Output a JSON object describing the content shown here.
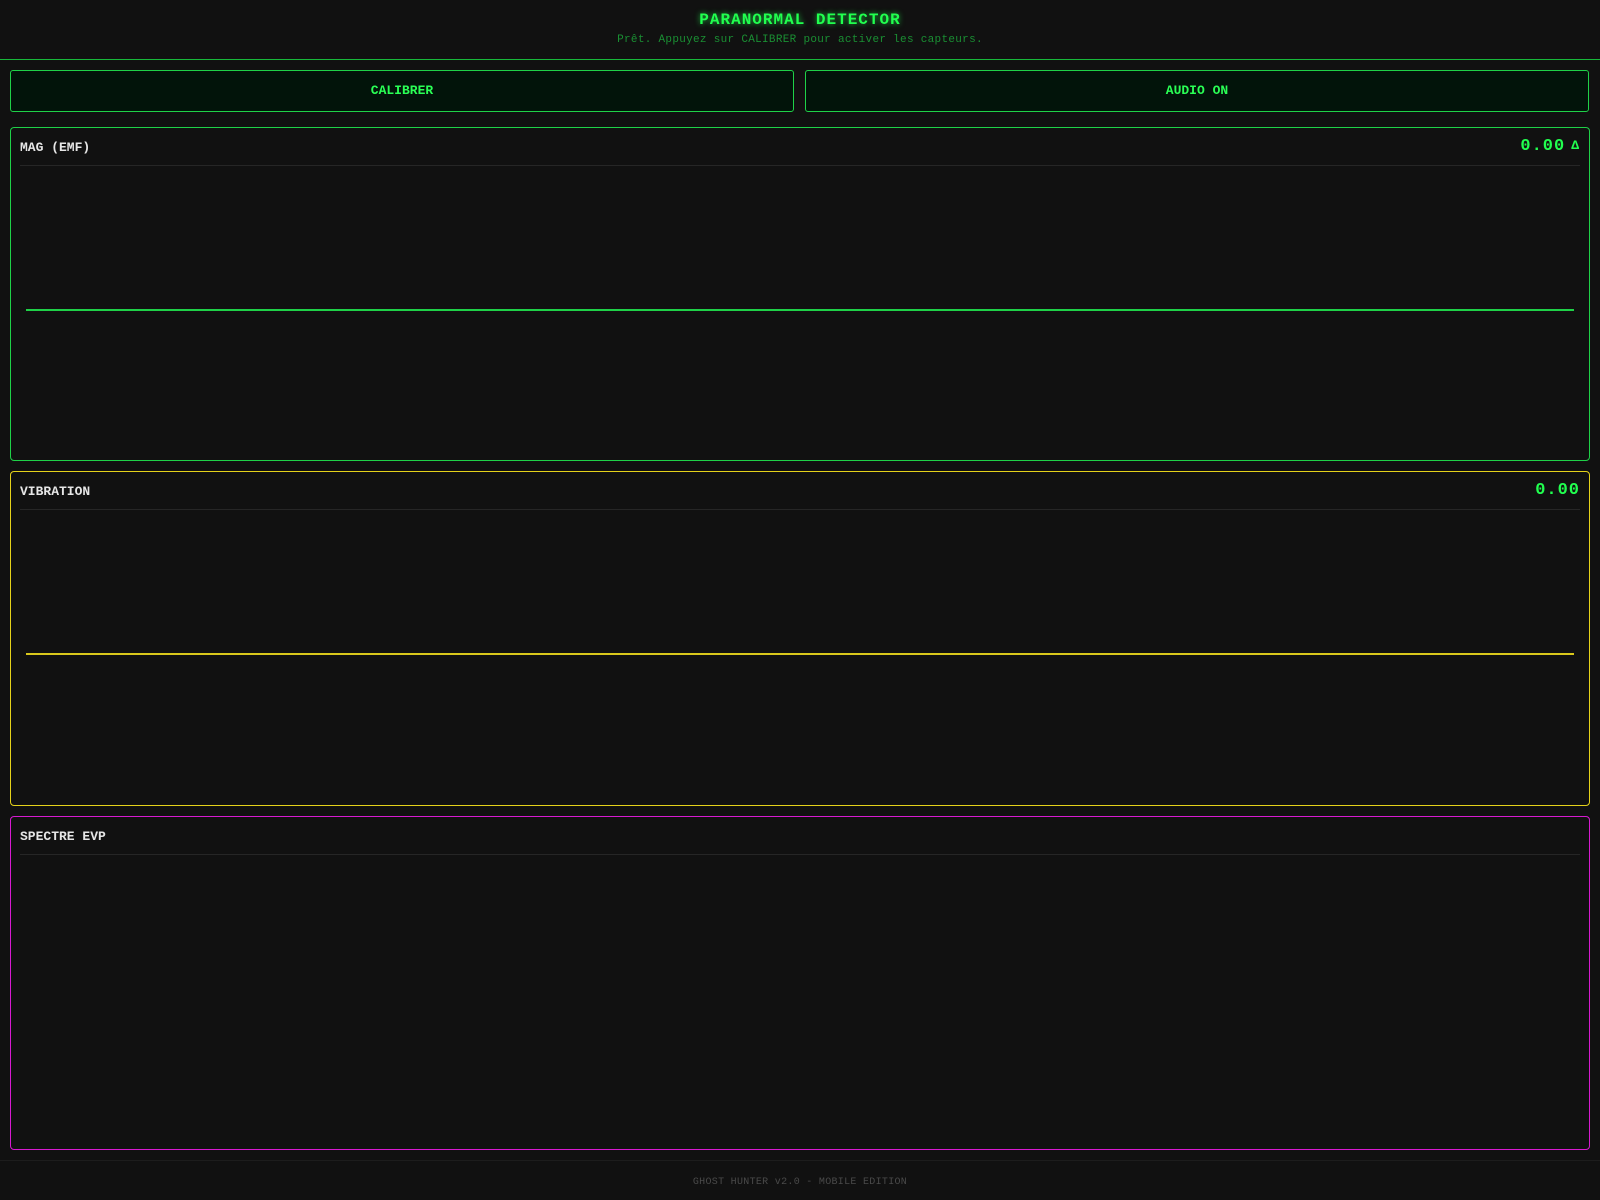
{
  "header": {
    "title": "PARANORMAL DETECTOR",
    "status": "Prêt. Appuyez sur CALIBRER pour activer les capteurs."
  },
  "controls": {
    "calibrate_label": "CALIBRER",
    "audio_label": "AUDIO ON"
  },
  "panels": {
    "mag": {
      "label": "MAG (EMF)",
      "value": "0.00",
      "delta_symbol": "Δ",
      "color": "#1fd148"
    },
    "vibration": {
      "label": "VIBRATION",
      "value": "0.00",
      "color": "#e5d21a"
    },
    "evp": {
      "label": "SPECTRE EVP",
      "color": "#d81ad1"
    }
  },
  "footer": {
    "text": "GHOST HUNTER v2.0 - MOBILE EDITION"
  },
  "colors": {
    "accent": "#21ff4f",
    "background": "#111111"
  }
}
